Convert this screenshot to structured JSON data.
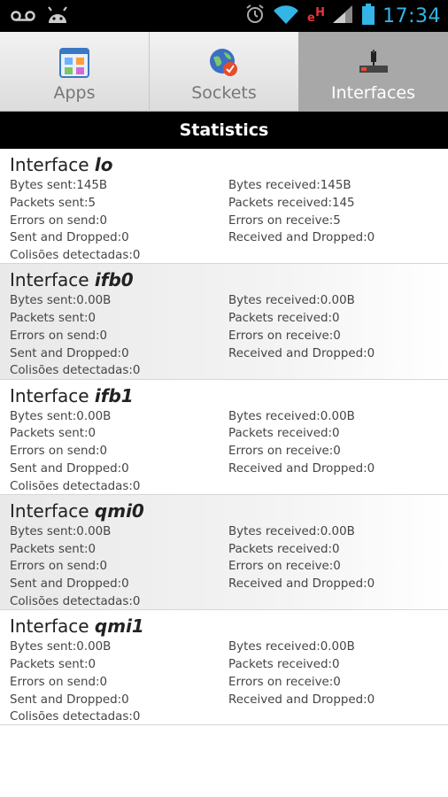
{
  "status_bar": {
    "time": "17:34",
    "carrier_badge": "H",
    "icons": [
      "voicemail-icon",
      "android-icon",
      "alarm-icon",
      "wifi-icon",
      "signal-icon",
      "battery-icon"
    ],
    "accent_color": "#33b5e5"
  },
  "tabs": [
    {
      "label": "Apps",
      "icon": "apps-icon",
      "selected": false
    },
    {
      "label": "Sockets",
      "icon": "sockets-icon",
      "selected": false
    },
    {
      "label": "Interfaces",
      "icon": "interfaces-icon",
      "selected": true
    }
  ],
  "header": {
    "title": "Statistics"
  },
  "interfaces": [
    {
      "prefix": "Interface ",
      "name": "lo",
      "rows": [
        [
          "Bytes sent:145B",
          "Bytes received:145B"
        ],
        [
          "Packets sent:5",
          "Packets received:145"
        ],
        [
          "Errors on send:0",
          "Errors on receive:5"
        ],
        [
          "Sent and Dropped:0",
          "Received and Dropped:0"
        ],
        [
          "Colisões detectadas:0",
          ""
        ]
      ]
    },
    {
      "prefix": "Interface ",
      "name": "ifb0",
      "rows": [
        [
          "Bytes sent:0.00B",
          "Bytes received:0.00B"
        ],
        [
          "Packets sent:0",
          "Packets received:0"
        ],
        [
          "Errors on send:0",
          "Errors on receive:0"
        ],
        [
          "Sent and Dropped:0",
          "Received and Dropped:0"
        ],
        [
          "Colisões detectadas:0",
          ""
        ]
      ]
    },
    {
      "prefix": "Interface ",
      "name": "ifb1",
      "rows": [
        [
          "Bytes sent:0.00B",
          "Bytes received:0.00B"
        ],
        [
          "Packets sent:0",
          "Packets received:0"
        ],
        [
          "Errors on send:0",
          "Errors on receive:0"
        ],
        [
          "Sent and Dropped:0",
          "Received and Dropped:0"
        ],
        [
          "Colisões detectadas:0",
          ""
        ]
      ]
    },
    {
      "prefix": "Interface ",
      "name": "qmi0",
      "rows": [
        [
          "Bytes sent:0.00B",
          "Bytes received:0.00B"
        ],
        [
          "Packets sent:0",
          "Packets received:0"
        ],
        [
          "Errors on send:0",
          "Errors on receive:0"
        ],
        [
          "Sent and Dropped:0",
          "Received and Dropped:0"
        ],
        [
          "Colisões detectadas:0",
          ""
        ]
      ]
    },
    {
      "prefix": "Interface ",
      "name": "qmi1",
      "rows": [
        [
          "Bytes sent:0.00B",
          "Bytes received:0.00B"
        ],
        [
          "Packets sent:0",
          "Packets received:0"
        ],
        [
          "Errors on send:0",
          "Errors on receive:0"
        ],
        [
          "Sent and Dropped:0",
          "Received and Dropped:0"
        ],
        [
          "Colisões detectadas:0",
          ""
        ]
      ]
    }
  ]
}
